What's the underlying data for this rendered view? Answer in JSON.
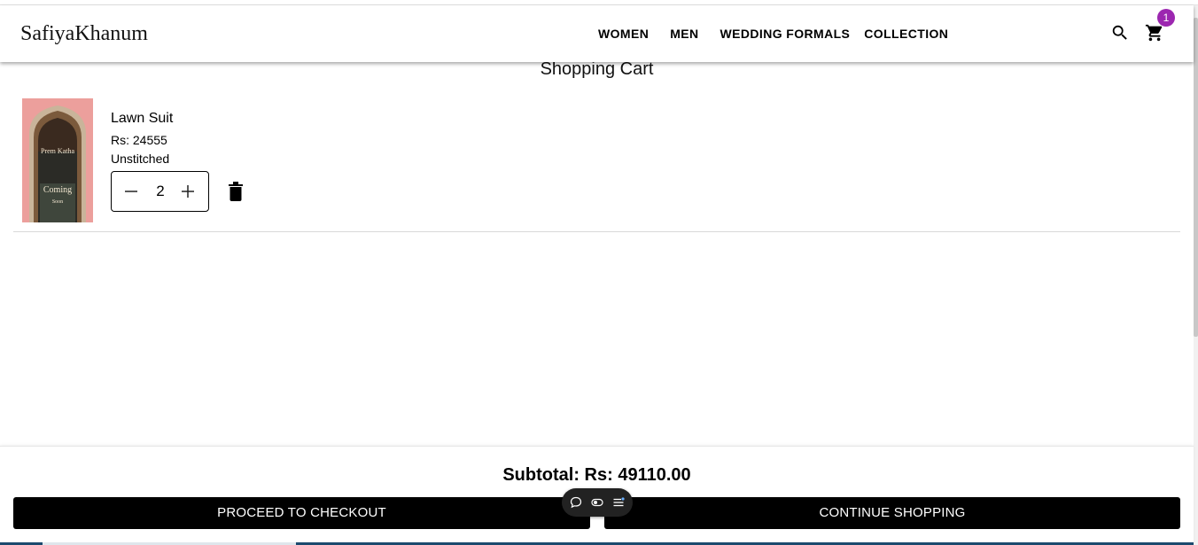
{
  "header": {
    "brand": "SafiyaKhanum",
    "nav": [
      "WOMEN",
      "MEN",
      "WEDDING FORMALS",
      "COLLECTION"
    ],
    "icons": {
      "search": "search-icon",
      "cart": "cart-icon"
    },
    "cart_count": "1",
    "badge_color": "#9c27b0"
  },
  "page": {
    "title": "Shopping Cart"
  },
  "cart": {
    "items": [
      {
        "name": "Lawn Suit",
        "price": "Rs: 24555",
        "variant": "Unstitched",
        "quantity": "2",
        "image_text": [
          "Prem Katha",
          "Coming",
          "Soon"
        ]
      }
    ]
  },
  "footer": {
    "subtotal": "Subtotal: Rs: 49110.00",
    "checkout_label": "PROCEED TO CHECKOUT",
    "continue_label": "CONTINUE SHOPPING"
  },
  "floating_toolbar": {
    "icons": [
      "chat-icon",
      "toggle-icon",
      "list-icon"
    ]
  }
}
